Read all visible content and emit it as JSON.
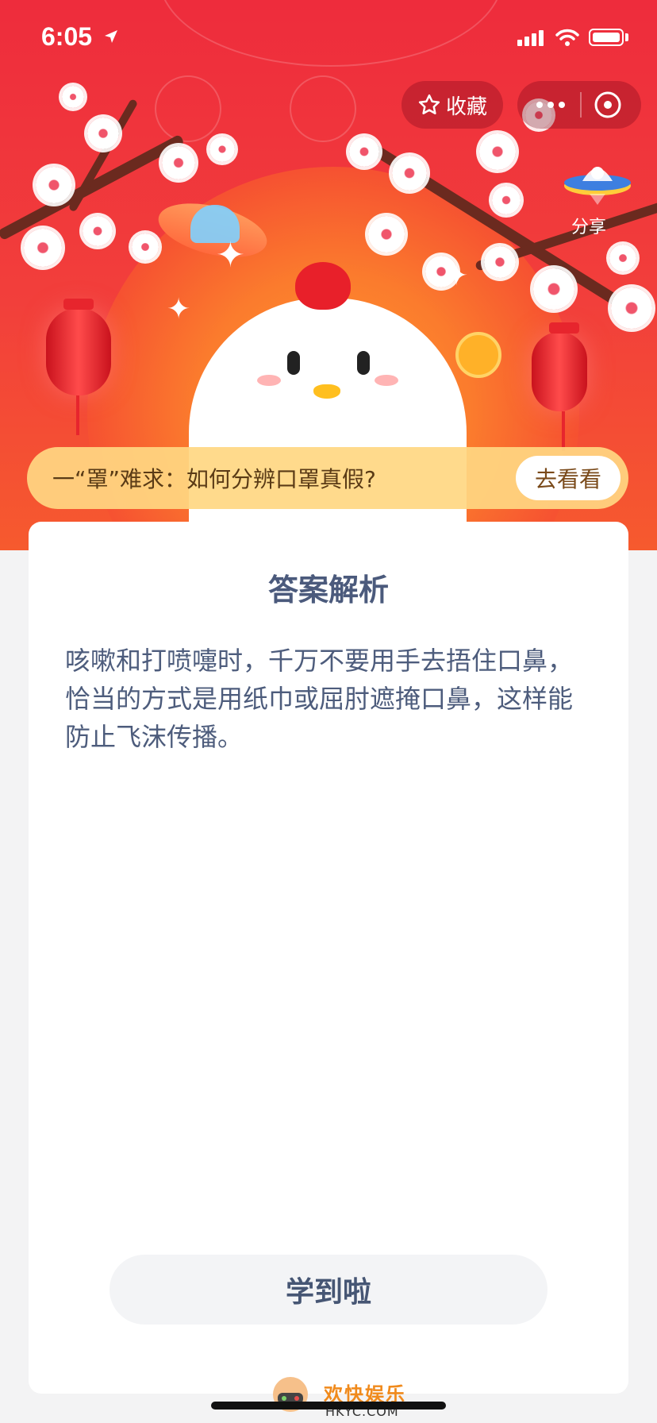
{
  "status_bar": {
    "time": "6:05",
    "icons": [
      "location-arrow-icon",
      "signal-icon",
      "wifi-icon",
      "battery-icon"
    ]
  },
  "top_controls": {
    "favorite_label": "收藏",
    "favorite_icon": "star-icon",
    "more_icon": "more-icon",
    "close_icon": "close-target-icon",
    "share_label": "分享",
    "share_icon": "ufo-share-icon"
  },
  "topic": {
    "text": "一“罩”难求：如何分辨口罩真假?",
    "button_label": "去看看"
  },
  "card": {
    "title": "答案解析",
    "body": "咳嗽和打喷嚏时，千万不要用手去捂住口鼻，恰当的方式是用纸巾或屈肘遮掩口鼻，这样能防止飞沫传播。",
    "button_label": "学到啦"
  },
  "watermark": {
    "name": "欢快娱乐",
    "domain": "HKYC.COM"
  },
  "colors": {
    "banner_red": "#ee2c3c",
    "banner_orange": "#f65a2e",
    "topic_bar": "#ffd782",
    "text_blue_gray": "#4b5a7c",
    "page_bg": "#f3f3f4"
  }
}
